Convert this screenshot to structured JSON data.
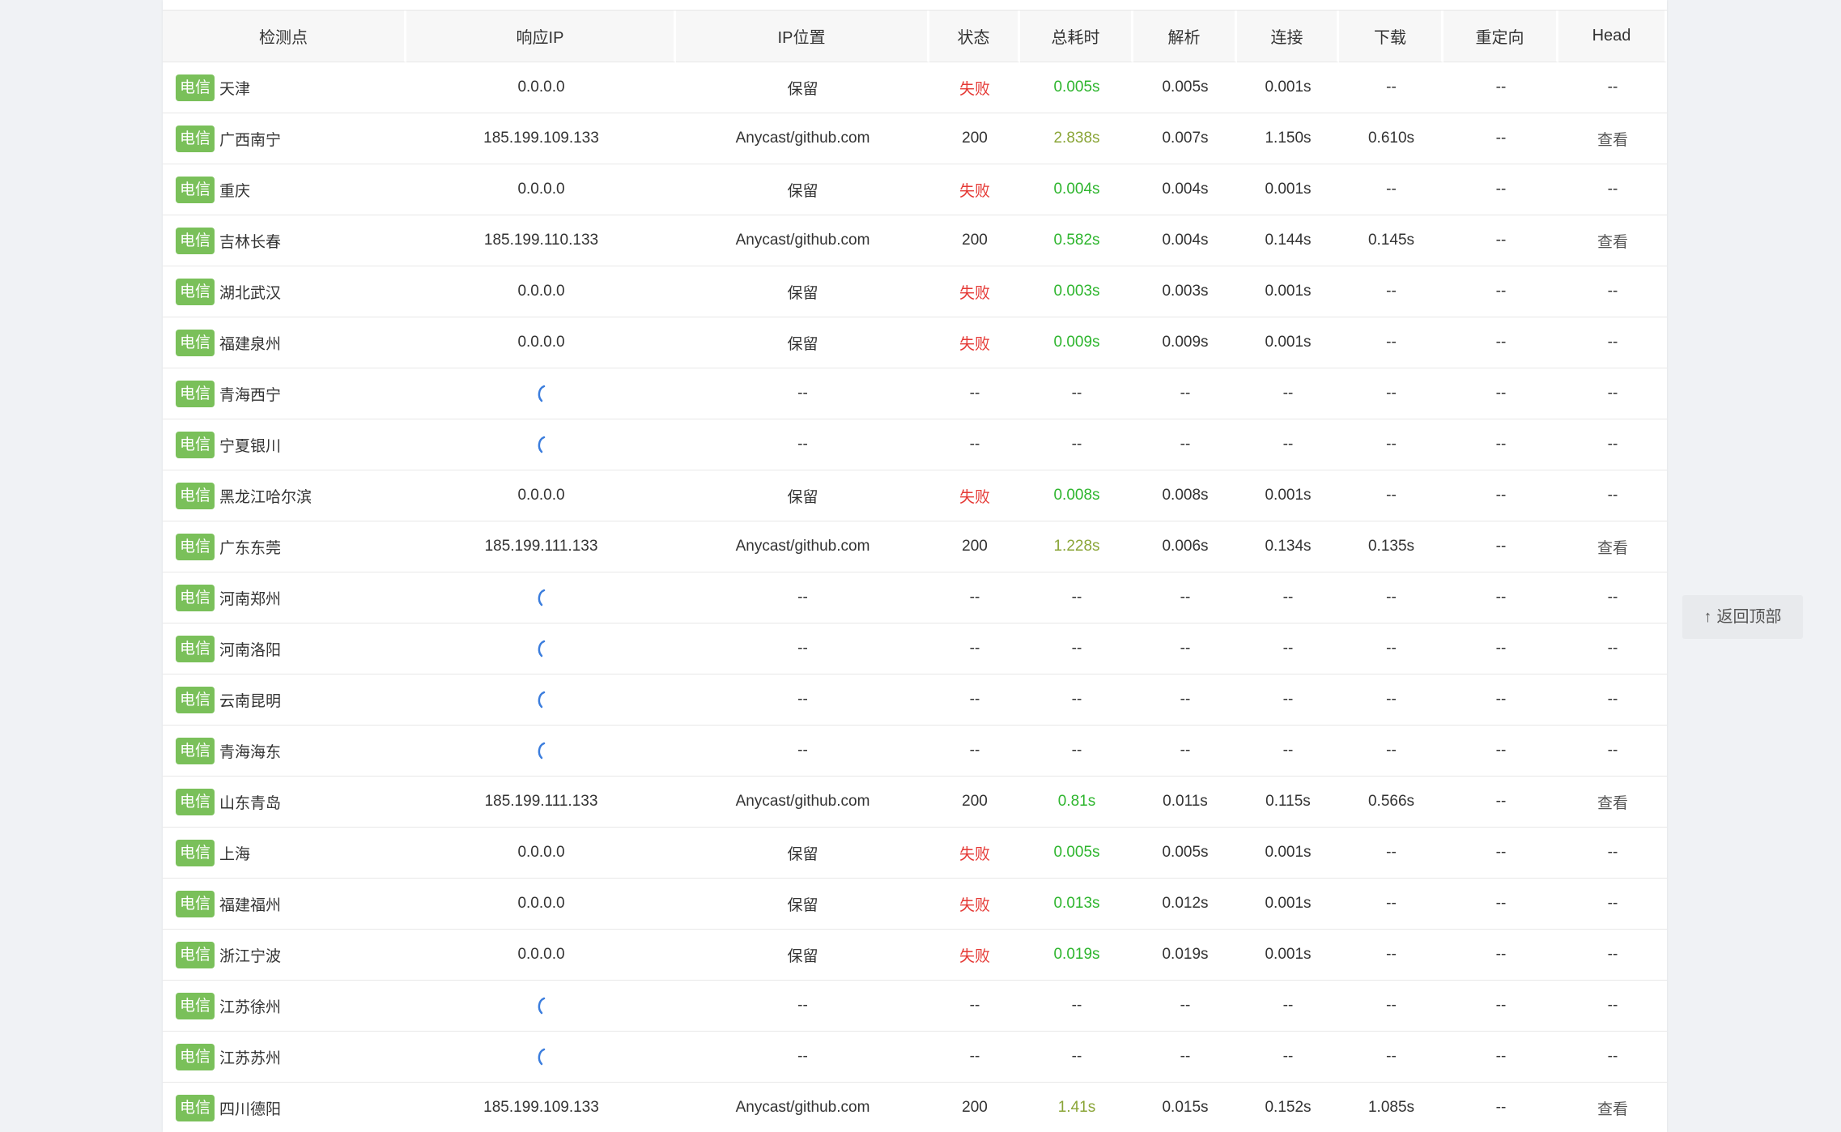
{
  "headers": [
    "检测点",
    "响应IP",
    "IP位置",
    "状态",
    "总耗时",
    "解析",
    "连接",
    "下载",
    "重定向",
    "Head"
  ],
  "isp_tag": "电信",
  "rows": [
    {
      "city": "天津",
      "ip": "0.0.0.0",
      "loc": "保留",
      "status": "失败",
      "total": "0.005s",
      "dns": "0.005s",
      "connect": "0.001s",
      "download": "--",
      "redirect": "--",
      "head": "--"
    },
    {
      "city": "广西南宁",
      "ip": "185.199.109.133",
      "loc": "Anycast/github.com",
      "status": "200",
      "total": "2.838s",
      "dns": "0.007s",
      "connect": "1.150s",
      "download": "0.610s",
      "redirect": "--",
      "head": "查看"
    },
    {
      "city": "重庆",
      "ip": "0.0.0.0",
      "loc": "保留",
      "status": "失败",
      "total": "0.004s",
      "dns": "0.004s",
      "connect": "0.001s",
      "download": "--",
      "redirect": "--",
      "head": "--"
    },
    {
      "city": "吉林长春",
      "ip": "185.199.110.133",
      "loc": "Anycast/github.com",
      "status": "200",
      "total": "0.582s",
      "dns": "0.004s",
      "connect": "0.144s",
      "download": "0.145s",
      "redirect": "--",
      "head": "查看"
    },
    {
      "city": "湖北武汉",
      "ip": "0.0.0.0",
      "loc": "保留",
      "status": "失败",
      "total": "0.003s",
      "dns": "0.003s",
      "connect": "0.001s",
      "download": "--",
      "redirect": "--",
      "head": "--"
    },
    {
      "city": "福建泉州",
      "ip": "0.0.0.0",
      "loc": "保留",
      "status": "失败",
      "total": "0.009s",
      "dns": "0.009s",
      "connect": "0.001s",
      "download": "--",
      "redirect": "--",
      "head": "--"
    },
    {
      "city": "青海西宁",
      "ip": "",
      "loc": "--",
      "status": "--",
      "total": "--",
      "dns": "--",
      "connect": "--",
      "download": "--",
      "redirect": "--",
      "head": "--",
      "loading": true
    },
    {
      "city": "宁夏银川",
      "ip": "",
      "loc": "--",
      "status": "--",
      "total": "--",
      "dns": "--",
      "connect": "--",
      "download": "--",
      "redirect": "--",
      "head": "--",
      "loading": true
    },
    {
      "city": "黑龙江哈尔滨",
      "ip": "0.0.0.0",
      "loc": "保留",
      "status": "失败",
      "total": "0.008s",
      "dns": "0.008s",
      "connect": "0.001s",
      "download": "--",
      "redirect": "--",
      "head": "--"
    },
    {
      "city": "广东东莞",
      "ip": "185.199.111.133",
      "loc": "Anycast/github.com",
      "status": "200",
      "total": "1.228s",
      "dns": "0.006s",
      "connect": "0.134s",
      "download": "0.135s",
      "redirect": "--",
      "head": "查看"
    },
    {
      "city": "河南郑州",
      "ip": "",
      "loc": "--",
      "status": "--",
      "total": "--",
      "dns": "--",
      "connect": "--",
      "download": "--",
      "redirect": "--",
      "head": "--",
      "loading": true
    },
    {
      "city": "河南洛阳",
      "ip": "",
      "loc": "--",
      "status": "--",
      "total": "--",
      "dns": "--",
      "connect": "--",
      "download": "--",
      "redirect": "--",
      "head": "--",
      "loading": true
    },
    {
      "city": "云南昆明",
      "ip": "",
      "loc": "--",
      "status": "--",
      "total": "--",
      "dns": "--",
      "connect": "--",
      "download": "--",
      "redirect": "--",
      "head": "--",
      "loading": true
    },
    {
      "city": "青海海东",
      "ip": "",
      "loc": "--",
      "status": "--",
      "total": "--",
      "dns": "--",
      "connect": "--",
      "download": "--",
      "redirect": "--",
      "head": "--",
      "loading": true
    },
    {
      "city": "山东青岛",
      "ip": "185.199.111.133",
      "loc": "Anycast/github.com",
      "status": "200",
      "total": "0.81s",
      "dns": "0.011s",
      "connect": "0.115s",
      "download": "0.566s",
      "redirect": "--",
      "head": "查看"
    },
    {
      "city": "上海",
      "ip": "0.0.0.0",
      "loc": "保留",
      "status": "失败",
      "total": "0.005s",
      "dns": "0.005s",
      "connect": "0.001s",
      "download": "--",
      "redirect": "--",
      "head": "--"
    },
    {
      "city": "福建福州",
      "ip": "0.0.0.0",
      "loc": "保留",
      "status": "失败",
      "total": "0.013s",
      "dns": "0.012s",
      "connect": "0.001s",
      "download": "--",
      "redirect": "--",
      "head": "--"
    },
    {
      "city": "浙江宁波",
      "ip": "0.0.0.0",
      "loc": "保留",
      "status": "失败",
      "total": "0.019s",
      "dns": "0.019s",
      "connect": "0.001s",
      "download": "--",
      "redirect": "--",
      "head": "--"
    },
    {
      "city": "江苏徐州",
      "ip": "",
      "loc": "--",
      "status": "--",
      "total": "--",
      "dns": "--",
      "connect": "--",
      "download": "--",
      "redirect": "--",
      "head": "--",
      "loading": true
    },
    {
      "city": "江苏苏州",
      "ip": "",
      "loc": "--",
      "status": "--",
      "total": "--",
      "dns": "--",
      "connect": "--",
      "download": "--",
      "redirect": "--",
      "head": "--",
      "loading": true
    },
    {
      "city": "四川德阳",
      "ip": "185.199.109.133",
      "loc": "Anycast/github.com",
      "status": "200",
      "total": "1.41s",
      "dns": "0.015s",
      "connect": "0.152s",
      "download": "1.085s",
      "redirect": "--",
      "head": "查看"
    }
  ],
  "back_to_top": {
    "icon": "arrow-up-icon",
    "label": "返回顶部"
  },
  "colors": {
    "tag": "#7ac05a",
    "fail": "#e53935",
    "fast": "#2db52d",
    "slow": "#8aa537",
    "spinner": "#3b7ddd"
  }
}
